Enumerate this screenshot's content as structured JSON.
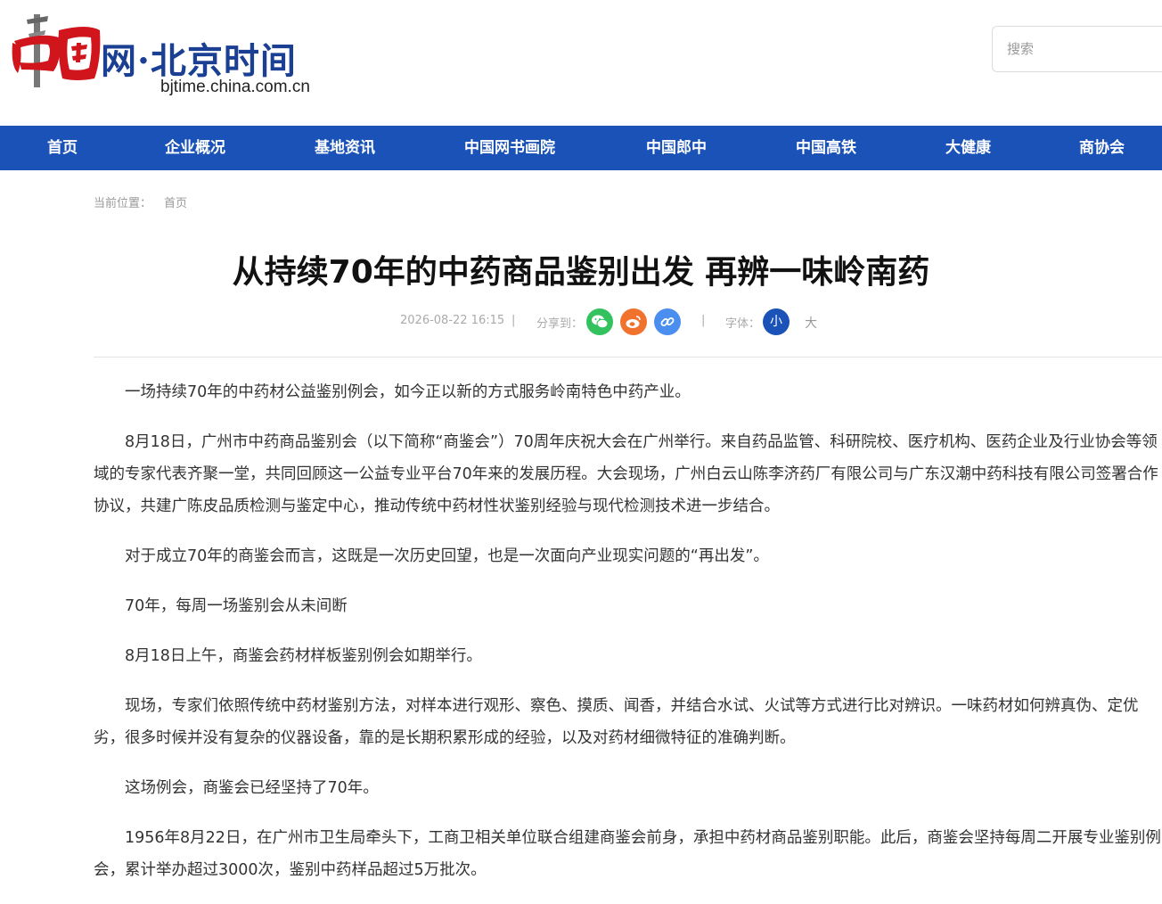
{
  "header": {
    "logo_text": "网·北京时间",
    "logo_domain": "bjtime.china.com.cn",
    "search_placeholder": "搜索"
  },
  "colors": {
    "brand_blue": "#1a52b7",
    "logo_red": "#d0151c",
    "wechat": "#34c25f",
    "weibo": "#f0722d",
    "link": "#4a8ef0"
  },
  "nav": {
    "items": [
      {
        "label": "首页"
      },
      {
        "label": "企业概况"
      },
      {
        "label": "基地资讯"
      },
      {
        "label": "中国网书画院"
      },
      {
        "label": "中国郎中"
      },
      {
        "label": "中国高铁"
      },
      {
        "label": "大健康"
      },
      {
        "label": "商协会"
      }
    ]
  },
  "breadcrumb": {
    "prefix": "当前位置：",
    "home": "首页"
  },
  "article": {
    "title": "从持续70年的中药商品鉴别出发 再辨一味岭南药",
    "datetime": "2026-08-22 16:15",
    "separator": "|",
    "share_label": "分享到：",
    "share_icons": [
      "wechat-icon",
      "weibo-icon",
      "link-icon"
    ],
    "font_label": "字体：",
    "font_small": "小",
    "font_large": "大",
    "paragraphs": [
      "一场持续70年的中药材公益鉴别例会，如今正以新的方式服务岭南特色中药产业。",
      "8月18日，广州市中药商品鉴别会（以下简称“商鉴会”）70周年庆祝大会在广州举行。来自药品监管、科研院校、医疗机构、医药企业及行业协会等领域的专家代表齐聚一堂，共同回顾这一公益专业平台70年来的发展历程。大会现场，广州白云山陈李济药厂有限公司与广东汉潮中药科技有限公司签署合作协议，共建广陈皮品质检测与鉴定中心，推动传统中药材性状鉴别经验与现代检测技术进一步结合。",
      "对于成立70年的商鉴会而言，这既是一次历史回望，也是一次面向产业现实问题的“再出发”。",
      "70年，每周一场鉴别会从未间断",
      "8月18日上午，商鉴会药材样板鉴别例会如期举行。",
      "现场，专家们依照传统中药材鉴别方法，对样本进行观形、察色、摸质、闻香，并结合水试、火试等方式进行比对辨识。一味药材如何辨真伪、定优劣，很多时候并没有复杂的仪器设备，靠的是长期积累形成的经验，以及对药材细微特征的准确判断。",
      "这场例会，商鉴会已经坚持了70年。",
      "1956年8月22日，在广州市卫生局牵头下，工商卫相关单位联合组建商鉴会前身，承担中药材商品鉴别职能。此后，商鉴会坚持每周二开展专业鉴别例会，累计举办超过3000次，鉴别中药样品超过5万批次。"
    ]
  }
}
